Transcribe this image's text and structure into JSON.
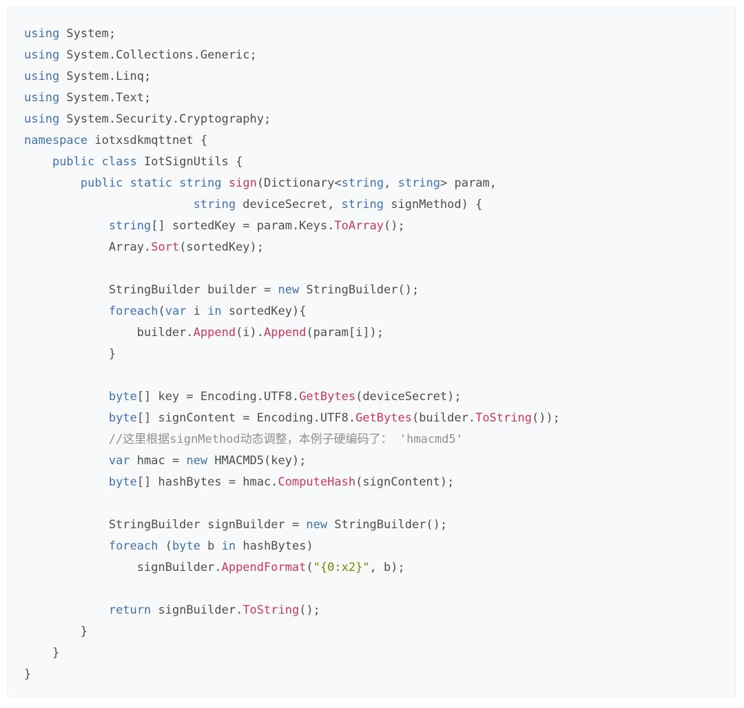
{
  "document": {
    "kind": "code-snippet",
    "language": "C#",
    "background_color": "#ffffff",
    "code_block_background": "#f8f9fa"
  },
  "theme": {
    "keyword_color": "#4271ae",
    "function_color": "#c9395b",
    "string_color": "#718c00",
    "comment_color": "#8e908c",
    "plain_color": "#4d4d4c"
  },
  "code": {
    "lines": [
      [
        {
          "t": "using",
          "c": "kw"
        },
        {
          "t": " System;",
          "c": "pln"
        }
      ],
      [
        {
          "t": "using",
          "c": "kw"
        },
        {
          "t": " System.Collections.Generic;",
          "c": "pln"
        }
      ],
      [
        {
          "t": "using",
          "c": "kw"
        },
        {
          "t": " System.Linq;",
          "c": "pln"
        }
      ],
      [
        {
          "t": "using",
          "c": "kw"
        },
        {
          "t": " System.Text;",
          "c": "pln"
        }
      ],
      [
        {
          "t": "using",
          "c": "kw"
        },
        {
          "t": " System.Security.Cryptography;",
          "c": "pln"
        }
      ],
      [
        {
          "t": "namespace",
          "c": "kw"
        },
        {
          "t": " iotxsdkmqttnet {",
          "c": "pln"
        }
      ],
      [
        {
          "t": "    ",
          "c": "pln"
        },
        {
          "t": "public",
          "c": "kw"
        },
        {
          "t": " ",
          "c": "pln"
        },
        {
          "t": "class",
          "c": "kw"
        },
        {
          "t": " IotSignUtils {",
          "c": "pln"
        }
      ],
      [
        {
          "t": "        ",
          "c": "pln"
        },
        {
          "t": "public",
          "c": "kw"
        },
        {
          "t": " ",
          "c": "pln"
        },
        {
          "t": "static",
          "c": "kw"
        },
        {
          "t": " ",
          "c": "pln"
        },
        {
          "t": "string",
          "c": "kw"
        },
        {
          "t": " ",
          "c": "pln"
        },
        {
          "t": "sign",
          "c": "fn"
        },
        {
          "t": "(Dictionary<",
          "c": "pln"
        },
        {
          "t": "string",
          "c": "kw"
        },
        {
          "t": ", ",
          "c": "pln"
        },
        {
          "t": "string",
          "c": "kw"
        },
        {
          "t": "> param,",
          "c": "pln"
        }
      ],
      [
        {
          "t": "                        ",
          "c": "pln"
        },
        {
          "t": "string",
          "c": "kw"
        },
        {
          "t": " deviceSecret, ",
          "c": "pln"
        },
        {
          "t": "string",
          "c": "kw"
        },
        {
          "t": " signMethod) {",
          "c": "pln"
        }
      ],
      [
        {
          "t": "            ",
          "c": "pln"
        },
        {
          "t": "string",
          "c": "kw"
        },
        {
          "t": "[] sortedKey = param.Keys.",
          "c": "pln"
        },
        {
          "t": "ToArray",
          "c": "fn"
        },
        {
          "t": "();",
          "c": "pln"
        }
      ],
      [
        {
          "t": "            Array.",
          "c": "pln"
        },
        {
          "t": "Sort",
          "c": "fn"
        },
        {
          "t": "(sortedKey);",
          "c": "pln"
        }
      ],
      [
        {
          "t": "",
          "c": "pln"
        }
      ],
      [
        {
          "t": "            StringBuilder builder = ",
          "c": "pln"
        },
        {
          "t": "new",
          "c": "kw"
        },
        {
          "t": " StringBuilder();",
          "c": "pln"
        }
      ],
      [
        {
          "t": "            ",
          "c": "pln"
        },
        {
          "t": "foreach",
          "c": "kw"
        },
        {
          "t": "(",
          "c": "pln"
        },
        {
          "t": "var",
          "c": "kw"
        },
        {
          "t": " i ",
          "c": "pln"
        },
        {
          "t": "in",
          "c": "kw"
        },
        {
          "t": " sortedKey){",
          "c": "pln"
        }
      ],
      [
        {
          "t": "                builder.",
          "c": "pln"
        },
        {
          "t": "Append",
          "c": "fn"
        },
        {
          "t": "(i).",
          "c": "pln"
        },
        {
          "t": "Append",
          "c": "fn"
        },
        {
          "t": "(param[i]);",
          "c": "pln"
        }
      ],
      [
        {
          "t": "            }",
          "c": "pln"
        }
      ],
      [
        {
          "t": "",
          "c": "pln"
        }
      ],
      [
        {
          "t": "            ",
          "c": "pln"
        },
        {
          "t": "byte",
          "c": "kw"
        },
        {
          "t": "[] key = Encoding.UTF8.",
          "c": "pln"
        },
        {
          "t": "GetBytes",
          "c": "fn"
        },
        {
          "t": "(deviceSecret);",
          "c": "pln"
        }
      ],
      [
        {
          "t": "            ",
          "c": "pln"
        },
        {
          "t": "byte",
          "c": "kw"
        },
        {
          "t": "[] signContent = Encoding.UTF8.",
          "c": "pln"
        },
        {
          "t": "GetBytes",
          "c": "fn"
        },
        {
          "t": "(builder.",
          "c": "pln"
        },
        {
          "t": "ToString",
          "c": "fn"
        },
        {
          "t": "());",
          "c": "pln"
        }
      ],
      [
        {
          "t": "            ",
          "c": "pln"
        },
        {
          "t": "//这里根据signMethod动态调整，本例子硬编码了： 'hmacmd5'",
          "c": "com"
        }
      ],
      [
        {
          "t": "            ",
          "c": "pln"
        },
        {
          "t": "var",
          "c": "kw"
        },
        {
          "t": " hmac = ",
          "c": "pln"
        },
        {
          "t": "new",
          "c": "kw"
        },
        {
          "t": " HMACMD5(key);",
          "c": "pln"
        }
      ],
      [
        {
          "t": "            ",
          "c": "pln"
        },
        {
          "t": "byte",
          "c": "kw"
        },
        {
          "t": "[] hashBytes = hmac.",
          "c": "pln"
        },
        {
          "t": "ComputeHash",
          "c": "fn"
        },
        {
          "t": "(signContent);",
          "c": "pln"
        }
      ],
      [
        {
          "t": "",
          "c": "pln"
        }
      ],
      [
        {
          "t": "            StringBuilder signBuilder = ",
          "c": "pln"
        },
        {
          "t": "new",
          "c": "kw"
        },
        {
          "t": " StringBuilder();",
          "c": "pln"
        }
      ],
      [
        {
          "t": "            ",
          "c": "pln"
        },
        {
          "t": "foreach",
          "c": "kw"
        },
        {
          "t": " (",
          "c": "pln"
        },
        {
          "t": "byte",
          "c": "kw"
        },
        {
          "t": " b ",
          "c": "pln"
        },
        {
          "t": "in",
          "c": "kw"
        },
        {
          "t": " hashBytes)",
          "c": "pln"
        }
      ],
      [
        {
          "t": "                signBuilder.",
          "c": "pln"
        },
        {
          "t": "AppendFormat",
          "c": "fn"
        },
        {
          "t": "(",
          "c": "pln"
        },
        {
          "t": "\"{0:x2}\"",
          "c": "str"
        },
        {
          "t": ", b);",
          "c": "pln"
        }
      ],
      [
        {
          "t": "",
          "c": "pln"
        }
      ],
      [
        {
          "t": "            ",
          "c": "pln"
        },
        {
          "t": "return",
          "c": "kw"
        },
        {
          "t": " signBuilder.",
          "c": "pln"
        },
        {
          "t": "ToString",
          "c": "fn"
        },
        {
          "t": "();",
          "c": "pln"
        }
      ],
      [
        {
          "t": "        }",
          "c": "pln"
        }
      ],
      [
        {
          "t": "    }",
          "c": "pln"
        }
      ],
      [
        {
          "t": "}",
          "c": "pln"
        }
      ]
    ]
  }
}
